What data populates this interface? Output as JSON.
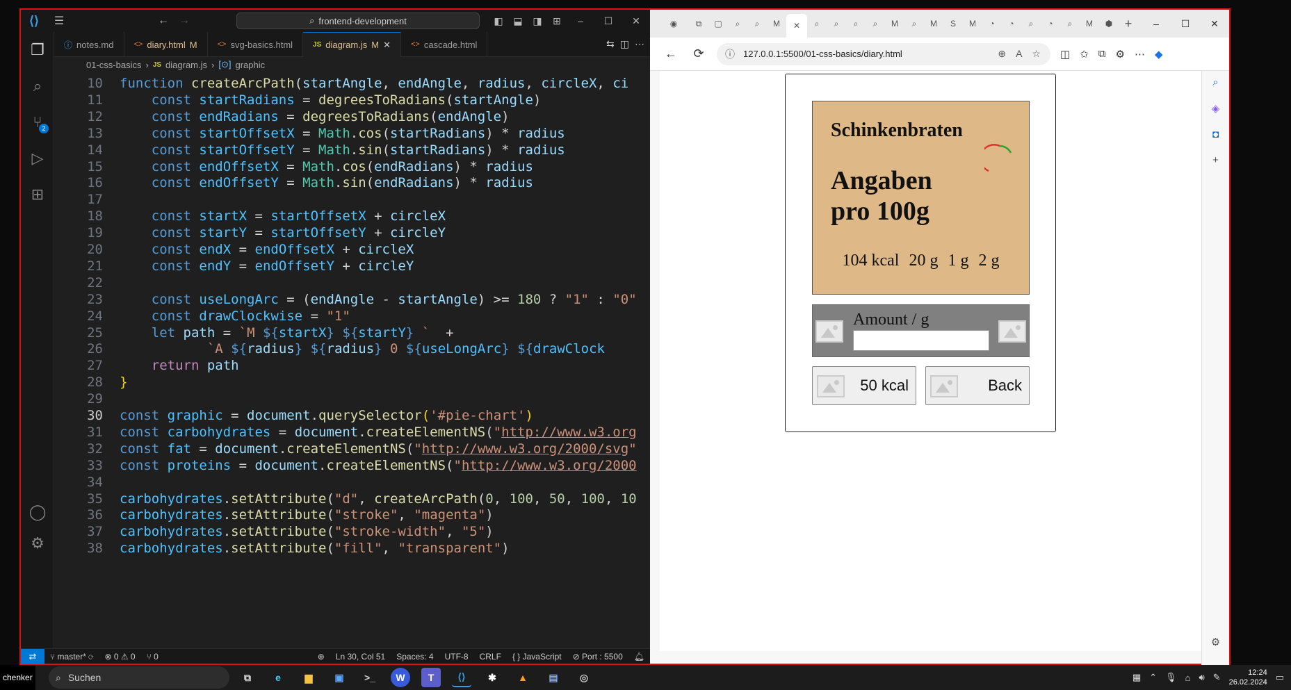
{
  "vscode": {
    "search_text": "frontend-development",
    "tabs": [
      {
        "icon": "md",
        "label": "notes.md",
        "modified": ""
      },
      {
        "icon": "html",
        "label": "diary.html",
        "modified": "M"
      },
      {
        "icon": "html",
        "label": "svg-basics.html",
        "modified": ""
      },
      {
        "icon": "js",
        "label": "diagram.js",
        "modified": "M"
      },
      {
        "icon": "html",
        "label": "cascade.html",
        "modified": ""
      }
    ],
    "active_tab": 3,
    "breadcrumb": [
      "01-css-basics",
      "diagram.js",
      "graphic"
    ],
    "scm_badge": "2",
    "code_lines": [
      {
        "n": "10",
        "tokens": [
          [
            "kw",
            "function "
          ],
          [
            "fn",
            "createArcPath"
          ],
          [
            "",
            "("
          ],
          [
            "vr",
            "startAngle"
          ],
          [
            "",
            ", "
          ],
          [
            "vr",
            "endAngle"
          ],
          [
            "",
            ", "
          ],
          [
            "vr",
            "radius"
          ],
          [
            "",
            ", "
          ],
          [
            "vr",
            "circleX"
          ],
          [
            "",
            ", "
          ],
          [
            "vr",
            "ci"
          ]
        ]
      },
      {
        "n": "11",
        "tokens": [
          [
            "",
            "    "
          ],
          [
            "kw",
            "const "
          ],
          [
            "cn",
            "startRadians"
          ],
          [
            "",
            " = "
          ],
          [
            "fn",
            "degreesToRadians"
          ],
          [
            "",
            "("
          ],
          [
            "vr",
            "startAngle"
          ],
          [
            "",
            ")"
          ]
        ]
      },
      {
        "n": "12",
        "tokens": [
          [
            "",
            "    "
          ],
          [
            "kw",
            "const "
          ],
          [
            "cn",
            "endRadians"
          ],
          [
            "",
            " = "
          ],
          [
            "fn",
            "degreesToRadians"
          ],
          [
            "",
            "("
          ],
          [
            "vr",
            "endAngle"
          ],
          [
            "",
            ")"
          ]
        ]
      },
      {
        "n": "13",
        "tokens": [
          [
            "",
            "    "
          ],
          [
            "kw",
            "const "
          ],
          [
            "cn",
            "startOffsetX"
          ],
          [
            "",
            " = "
          ],
          [
            "cls",
            "Math"
          ],
          [
            "",
            "."
          ],
          [
            "fn",
            "cos"
          ],
          [
            "",
            "("
          ],
          [
            "vr",
            "startRadians"
          ],
          [
            "",
            ") * "
          ],
          [
            "vr",
            "radius"
          ]
        ]
      },
      {
        "n": "14",
        "tokens": [
          [
            "",
            "    "
          ],
          [
            "kw",
            "const "
          ],
          [
            "cn",
            "startOffsetY"
          ],
          [
            "",
            " = "
          ],
          [
            "cls",
            "Math"
          ],
          [
            "",
            "."
          ],
          [
            "fn",
            "sin"
          ],
          [
            "",
            "("
          ],
          [
            "vr",
            "startRadians"
          ],
          [
            "",
            ") * "
          ],
          [
            "vr",
            "radius"
          ]
        ]
      },
      {
        "n": "15",
        "tokens": [
          [
            "",
            "    "
          ],
          [
            "kw",
            "const "
          ],
          [
            "cn",
            "endOffsetX"
          ],
          [
            "",
            " = "
          ],
          [
            "cls",
            "Math"
          ],
          [
            "",
            "."
          ],
          [
            "fn",
            "cos"
          ],
          [
            "",
            "("
          ],
          [
            "vr",
            "endRadians"
          ],
          [
            "",
            ") * "
          ],
          [
            "vr",
            "radius"
          ]
        ]
      },
      {
        "n": "16",
        "tokens": [
          [
            "",
            "    "
          ],
          [
            "kw",
            "const "
          ],
          [
            "cn",
            "endOffsetY"
          ],
          [
            "",
            " = "
          ],
          [
            "cls",
            "Math"
          ],
          [
            "",
            "."
          ],
          [
            "fn",
            "sin"
          ],
          [
            "",
            "("
          ],
          [
            "vr",
            "endRadians"
          ],
          [
            "",
            ") * "
          ],
          [
            "vr",
            "radius"
          ]
        ]
      },
      {
        "n": "17",
        "tokens": []
      },
      {
        "n": "18",
        "tokens": [
          [
            "",
            "    "
          ],
          [
            "kw",
            "const "
          ],
          [
            "cn",
            "startX"
          ],
          [
            "",
            " = "
          ],
          [
            "cn",
            "startOffsetX"
          ],
          [
            "",
            " + "
          ],
          [
            "vr",
            "circleX"
          ]
        ]
      },
      {
        "n": "19",
        "tokens": [
          [
            "",
            "    "
          ],
          [
            "kw",
            "const "
          ],
          [
            "cn",
            "startY"
          ],
          [
            "",
            " = "
          ],
          [
            "cn",
            "startOffsetY"
          ],
          [
            "",
            " + "
          ],
          [
            "vr",
            "circleY"
          ]
        ]
      },
      {
        "n": "20",
        "tokens": [
          [
            "",
            "    "
          ],
          [
            "kw",
            "const "
          ],
          [
            "cn",
            "endX"
          ],
          [
            "",
            " = "
          ],
          [
            "cn",
            "endOffsetX"
          ],
          [
            "",
            " + "
          ],
          [
            "vr",
            "circleX"
          ]
        ]
      },
      {
        "n": "21",
        "tokens": [
          [
            "",
            "    "
          ],
          [
            "kw",
            "const "
          ],
          [
            "cn",
            "endY"
          ],
          [
            "",
            " = "
          ],
          [
            "cn",
            "endOffsetY"
          ],
          [
            "",
            " + "
          ],
          [
            "vr",
            "circleY"
          ]
        ]
      },
      {
        "n": "22",
        "tokens": []
      },
      {
        "n": "23",
        "tokens": [
          [
            "",
            "    "
          ],
          [
            "kw",
            "const "
          ],
          [
            "cn",
            "useLongArc"
          ],
          [
            "",
            " = ("
          ],
          [
            "vr",
            "endAngle"
          ],
          [
            "",
            " - "
          ],
          [
            "vr",
            "startAngle"
          ],
          [
            "",
            ") >= "
          ],
          [
            "num",
            "180"
          ],
          [
            "",
            " ? "
          ],
          [
            "str",
            "\"1\""
          ],
          [
            "",
            " : "
          ],
          [
            "str",
            "\"0\""
          ]
        ]
      },
      {
        "n": "24",
        "tokens": [
          [
            "",
            "    "
          ],
          [
            "kw",
            "const "
          ],
          [
            "cn",
            "drawClockwise"
          ],
          [
            "",
            " = "
          ],
          [
            "str",
            "\"1\""
          ]
        ]
      },
      {
        "n": "25",
        "tokens": [
          [
            "",
            "    "
          ],
          [
            "kw",
            "let "
          ],
          [
            "vr",
            "path"
          ],
          [
            "",
            " = "
          ],
          [
            "str",
            "`M "
          ],
          [
            "kw",
            "${"
          ],
          [
            "cn",
            "startX"
          ],
          [
            "kw",
            "}"
          ],
          [
            "str",
            " "
          ],
          [
            "kw",
            "${"
          ],
          [
            "cn",
            "startY"
          ],
          [
            "kw",
            "}"
          ],
          [
            "str",
            " ` "
          ],
          [
            "",
            " +"
          ]
        ]
      },
      {
        "n": "26",
        "tokens": [
          [
            "",
            "           "
          ],
          [
            "str",
            "`A "
          ],
          [
            "kw",
            "${"
          ],
          [
            "vr",
            "radius"
          ],
          [
            "kw",
            "}"
          ],
          [
            "str",
            " "
          ],
          [
            "kw",
            "${"
          ],
          [
            "vr",
            "radius"
          ],
          [
            "kw",
            "}"
          ],
          [
            "str",
            " 0 "
          ],
          [
            "kw",
            "${"
          ],
          [
            "cn",
            "useLongArc"
          ],
          [
            "kw",
            "}"
          ],
          [
            "str",
            " "
          ],
          [
            "kw",
            "${"
          ],
          [
            "cn",
            "drawClock"
          ]
        ]
      },
      {
        "n": "27",
        "tokens": [
          [
            "",
            "    "
          ],
          [
            "ctl",
            "return "
          ],
          [
            "vr",
            "path"
          ]
        ]
      },
      {
        "n": "28",
        "tokens": [
          [
            "br",
            "}"
          ]
        ]
      },
      {
        "n": "29",
        "tokens": []
      },
      {
        "n": "30",
        "tokens": [
          [
            "kw",
            "const "
          ],
          [
            "cn",
            "graphic"
          ],
          [
            "",
            " = "
          ],
          [
            "vr",
            "document"
          ],
          [
            "",
            "."
          ],
          [
            "fn",
            "querySelector"
          ],
          [
            "br",
            "("
          ],
          [
            "str",
            "'#pie-chart'"
          ],
          [
            "br",
            ")"
          ]
        ]
      },
      {
        "n": "31",
        "tokens": [
          [
            "kw",
            "const "
          ],
          [
            "cn",
            "carbohydrates"
          ],
          [
            "",
            " = "
          ],
          [
            "vr",
            "document"
          ],
          [
            "",
            "."
          ],
          [
            "fn",
            "createElementNS"
          ],
          [
            "",
            "("
          ],
          [
            "str",
            "\""
          ],
          [
            "url",
            "http://www.w3.org"
          ]
        ]
      },
      {
        "n": "32",
        "tokens": [
          [
            "kw",
            "const "
          ],
          [
            "cn",
            "fat"
          ],
          [
            "",
            " = "
          ],
          [
            "vr",
            "document"
          ],
          [
            "",
            "."
          ],
          [
            "fn",
            "createElementNS"
          ],
          [
            "",
            "("
          ],
          [
            "str",
            "\""
          ],
          [
            "url",
            "http://www.w3.org/2000/svg"
          ],
          [
            "str",
            "\""
          ]
        ]
      },
      {
        "n": "33",
        "tokens": [
          [
            "kw",
            "const "
          ],
          [
            "cn",
            "proteins"
          ],
          [
            "",
            " = "
          ],
          [
            "vr",
            "document"
          ],
          [
            "",
            "."
          ],
          [
            "fn",
            "createElementNS"
          ],
          [
            "",
            "("
          ],
          [
            "str",
            "\""
          ],
          [
            "url",
            "http://www.w3.org/2000"
          ]
        ]
      },
      {
        "n": "34",
        "tokens": []
      },
      {
        "n": "35",
        "tokens": [
          [
            "cn",
            "carbohydrates"
          ],
          [
            "",
            "."
          ],
          [
            "fn",
            "setAttribute"
          ],
          [
            "",
            "("
          ],
          [
            "str",
            "\"d\""
          ],
          [
            "",
            ", "
          ],
          [
            "fn",
            "createArcPath"
          ],
          [
            "",
            "("
          ],
          [
            "num",
            "0"
          ],
          [
            "",
            ", "
          ],
          [
            "num",
            "100"
          ],
          [
            "",
            ", "
          ],
          [
            "num",
            "50"
          ],
          [
            "",
            ", "
          ],
          [
            "num",
            "100"
          ],
          [
            "",
            ", "
          ],
          [
            "num",
            "10"
          ]
        ]
      },
      {
        "n": "36",
        "tokens": [
          [
            "cn",
            "carbohydrates"
          ],
          [
            "",
            "."
          ],
          [
            "fn",
            "setAttribute"
          ],
          [
            "",
            "("
          ],
          [
            "str",
            "\"stroke\""
          ],
          [
            "",
            ", "
          ],
          [
            "str",
            "\"magenta\""
          ],
          [
            "",
            ")"
          ]
        ]
      },
      {
        "n": "37",
        "tokens": [
          [
            "cn",
            "carbohydrates"
          ],
          [
            "",
            "."
          ],
          [
            "fn",
            "setAttribute"
          ],
          [
            "",
            "("
          ],
          [
            "str",
            "\"stroke-width\""
          ],
          [
            "",
            ", "
          ],
          [
            "str",
            "\"5\""
          ],
          [
            "",
            ")"
          ]
        ]
      },
      {
        "n": "38",
        "tokens": [
          [
            "cn",
            "carbohydrates"
          ],
          [
            "",
            "."
          ],
          [
            "fn",
            "setAttribute"
          ],
          [
            "",
            "("
          ],
          [
            "str",
            "\"fill\""
          ],
          [
            "",
            ", "
          ],
          [
            "str",
            "\"transparent\""
          ],
          [
            "",
            ")"
          ]
        ]
      }
    ],
    "current_line": "30",
    "status": {
      "branch": "master*",
      "problems": "⊗ 0 ⚠ 0",
      "ports": "⑂ 0",
      "position": "Ln 30, Col 51",
      "spaces": "Spaces: 4",
      "encoding": "UTF-8",
      "eol": "CRLF",
      "language": "{ } JavaScript",
      "port": "Port : 5500"
    }
  },
  "browser": {
    "url": "127.0.0.1:5500/01-css-basics/diary.html",
    "page": {
      "dish": "Schinkenbraten",
      "heading": "Angaben pro 100g",
      "values": [
        "104 kcal",
        "20 g",
        "1 g",
        "2 g"
      ],
      "amount_label": "Amount / g",
      "amount_value": "",
      "buttons": [
        "50 kcal",
        "Back"
      ],
      "arc_color": "#e03030",
      "arc_color_2": "#2aa52a"
    }
  },
  "taskbar": {
    "user": "chenker",
    "search_placeholder": "Suchen",
    "time": "12:24",
    "date": "26.02.2024"
  }
}
